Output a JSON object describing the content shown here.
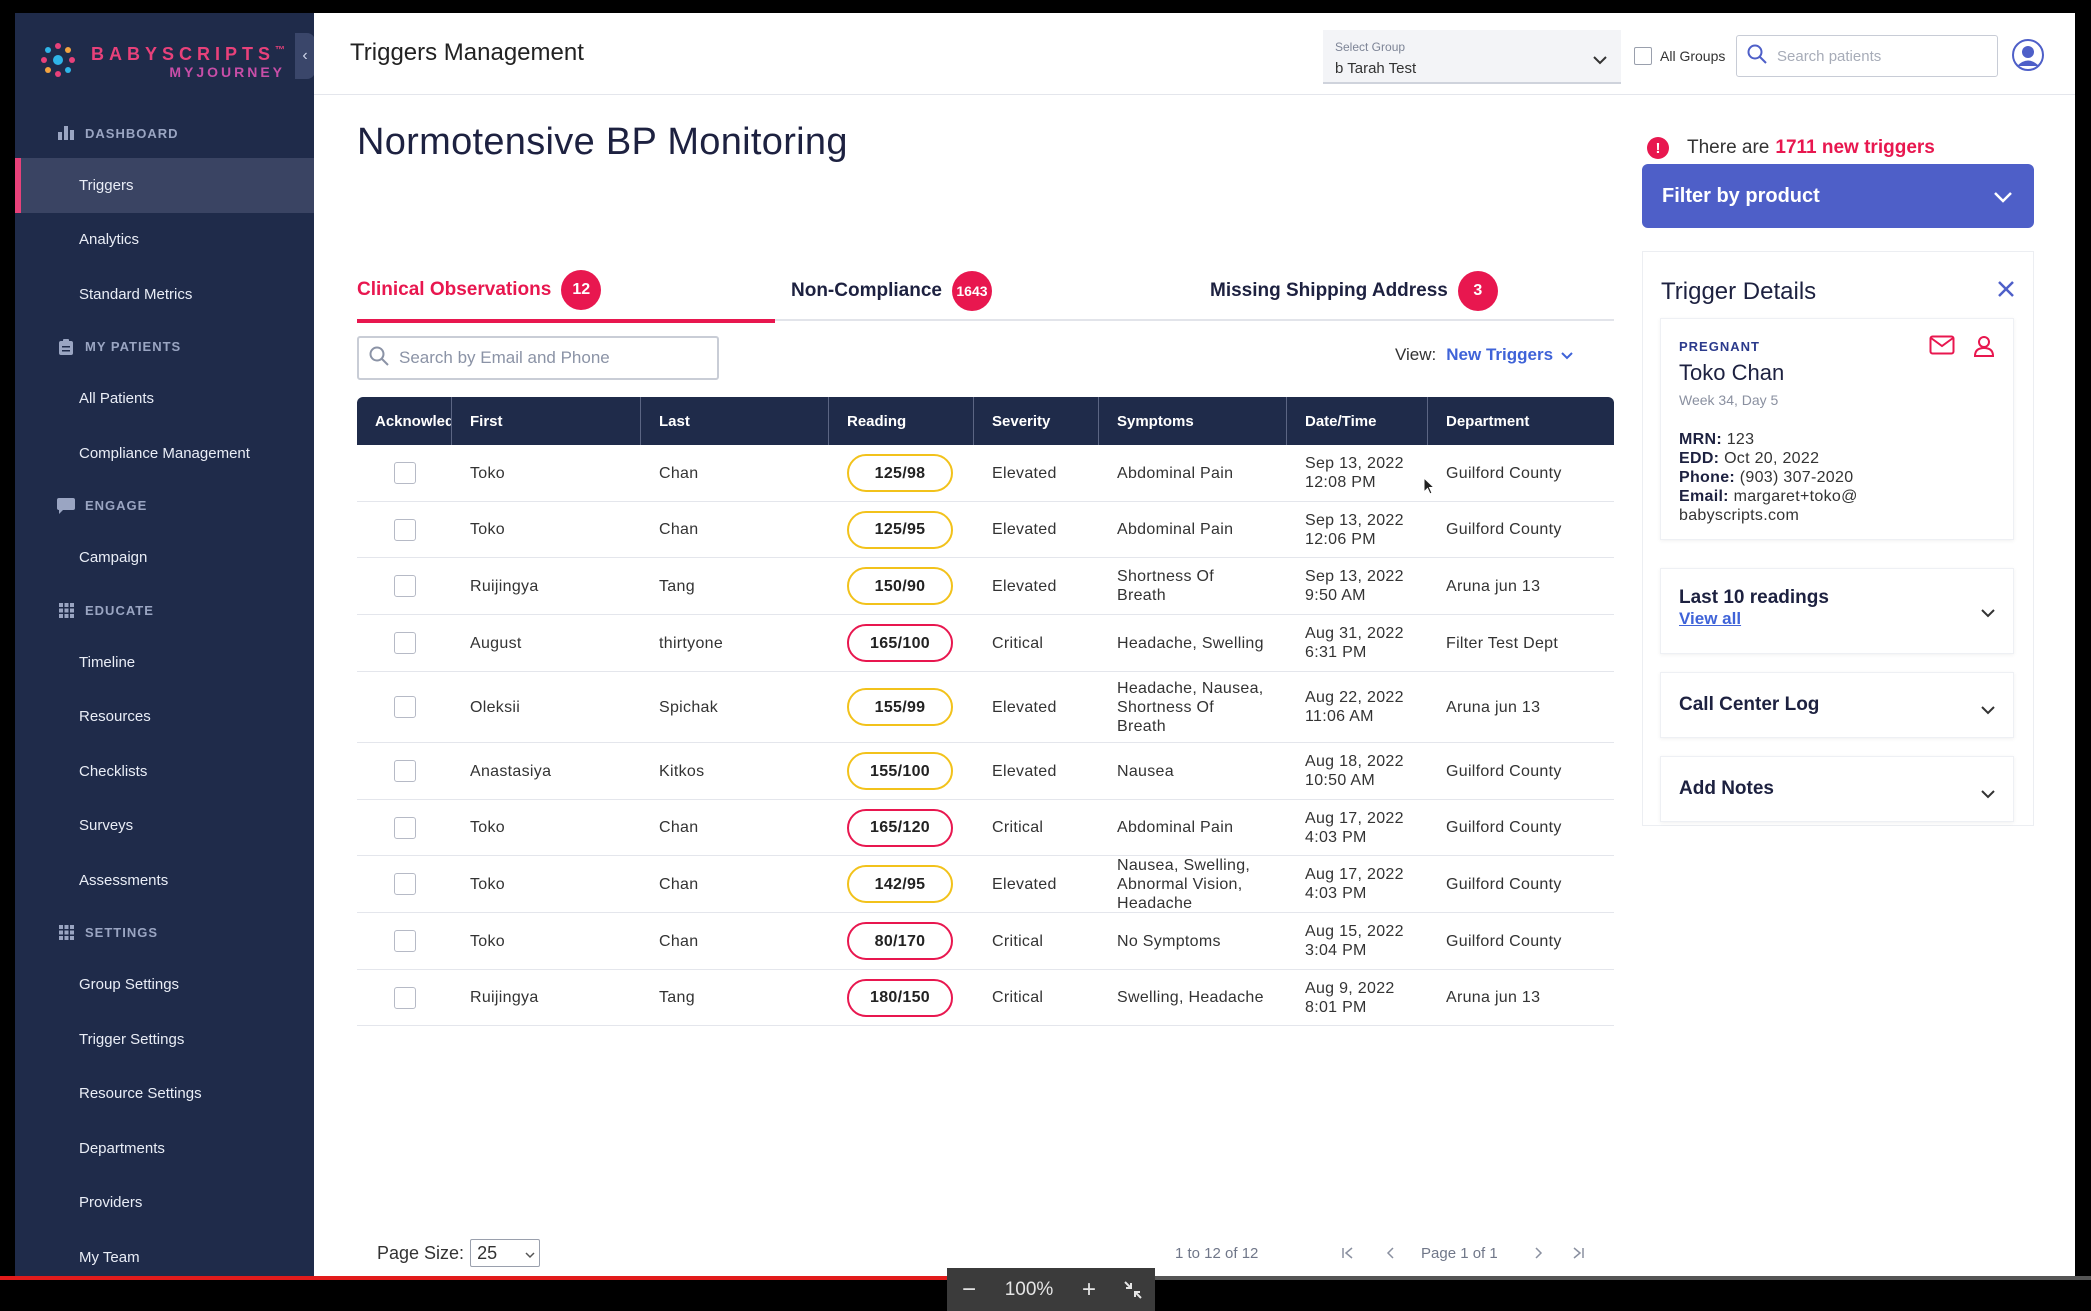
{
  "brand": {
    "name": "BABYSCRIPTS",
    "tm": "™",
    "sub": "MYJOURNEY"
  },
  "sidebar": {
    "sections": [
      {
        "label": "DASHBOARD",
        "icon": "bar-chart-icon",
        "items": [
          "Triggers",
          "Analytics",
          "Standard Metrics"
        ]
      },
      {
        "label": "MY PATIENTS",
        "icon": "clipboard-icon",
        "items": [
          "All Patients",
          "Compliance Management"
        ]
      },
      {
        "label": "ENGAGE",
        "icon": "chat-icon",
        "items": [
          "Campaign"
        ]
      },
      {
        "label": "EDUCATE",
        "icon": "grid-icon",
        "items": [
          "Timeline",
          "Resources",
          "Checklists",
          "Surveys",
          "Assessments"
        ]
      },
      {
        "label": "SETTINGS",
        "icon": "grid-icon",
        "items": [
          "Group Settings",
          "Trigger Settings",
          "Resource Settings",
          "Departments",
          "Providers",
          "My Team"
        ]
      }
    ],
    "active_item": "Triggers"
  },
  "header": {
    "title": "Triggers Management",
    "group_label": "Select Group",
    "group_value": "b Tarah Test",
    "all_groups": "All Groups",
    "search_placeholder": "Search patients"
  },
  "page_title": "Normotensive BP Monitoring",
  "tabs": [
    {
      "label": "Clinical Observations",
      "count": "12",
      "active": true
    },
    {
      "label": "Non-Compliance",
      "count": "1643",
      "active": false
    },
    {
      "label": "Missing Shipping Address",
      "count": "3",
      "active": false
    }
  ],
  "table_search_placeholder": "Search by Email and Phone",
  "view": {
    "label": "View:",
    "value": "New Triggers"
  },
  "table": {
    "columns": [
      "Acknowledge",
      "First",
      "Last",
      "Reading",
      "Severity",
      "Symptoms",
      "Date/Time",
      "Department"
    ],
    "rows": [
      {
        "first": "Toko",
        "last": "Chan",
        "reading": "125/98",
        "severity": "Elevated",
        "symptoms": "Abdominal Pain",
        "date": "Sep 13, 2022 12:08 PM",
        "department": "Guilford County"
      },
      {
        "first": "Toko",
        "last": "Chan",
        "reading": "125/95",
        "severity": "Elevated",
        "symptoms": "Abdominal Pain",
        "date": "Sep 13, 2022 12:06 PM",
        "department": "Guilford County"
      },
      {
        "first": "Ruijingya",
        "last": "Tang",
        "reading": "150/90",
        "severity": "Elevated",
        "symptoms": "Shortness Of Breath",
        "date": "Sep 13, 2022 9:50 AM",
        "department": "Aruna jun 13"
      },
      {
        "first": "August",
        "last": "thirtyone",
        "reading": "165/100",
        "severity": "Critical",
        "symptoms": "Headache, Swelling",
        "date": "Aug 31, 2022 6:31 PM",
        "department": "Filter Test Dept"
      },
      {
        "first": "Oleksii",
        "last": "Spichak",
        "reading": "155/99",
        "severity": "Elevated",
        "symptoms": "Headache, Nausea, Shortness Of Breath",
        "date": "Aug 22, 2022 11:06 AM",
        "department": "Aruna jun 13"
      },
      {
        "first": "Anastasiya",
        "last": "Kitkos",
        "reading": "155/100",
        "severity": "Elevated",
        "symptoms": "Nausea",
        "date": "Aug 18, 2022 10:50 AM",
        "department": "Guilford County"
      },
      {
        "first": "Toko",
        "last": "Chan",
        "reading": "165/120",
        "severity": "Critical",
        "symptoms": "Abdominal Pain",
        "date": "Aug 17, 2022 4:03 PM",
        "department": "Guilford County"
      },
      {
        "first": "Toko",
        "last": "Chan",
        "reading": "142/95",
        "severity": "Elevated",
        "symptoms": "Nausea, Swelling, Abnormal Vision, Headache",
        "date": "Aug 17, 2022 4:03 PM",
        "department": "Guilford County"
      },
      {
        "first": "Toko",
        "last": "Chan",
        "reading": "80/170",
        "severity": "Critical",
        "symptoms": "No Symptoms",
        "date": "Aug 15, 2022 3:04 PM",
        "department": "Guilford County"
      },
      {
        "first": "Ruijingya",
        "last": "Tang",
        "reading": "180/150",
        "severity": "Critical",
        "symptoms": "Swelling, Headache",
        "date": "Aug 9, 2022 8:01 PM",
        "department": "Aruna jun 13"
      }
    ]
  },
  "pager": {
    "size_label": "Page Size:",
    "size_value": "25",
    "count": "1 to 12 of 12",
    "page": "Page 1 of 1"
  },
  "alert": {
    "prefix": "There are",
    "highlight": "1711 new triggers"
  },
  "filter_product": "Filter by product",
  "details": {
    "title": "Trigger Details",
    "status": "PREGNANT",
    "name": "Toko Chan",
    "week": "Week 34, Day 5",
    "mrn_label": "MRN:",
    "mrn": "123",
    "edd_label": "EDD:",
    "edd": "Oct 20, 2022",
    "phone_label": "Phone:",
    "phone": "(903) 307-2020",
    "email_label": "Email:",
    "email_1": "margaret+toko@",
    "email_2": "babyscripts.com",
    "last_readings": "Last 10 readings",
    "view_all": "View all",
    "call_log": "Call Center Log",
    "add_notes": "Add Notes"
  },
  "video": {
    "zoom": "100%"
  },
  "colors": {
    "sidebar": "#1f2b4a",
    "accent": "#e8174f",
    "primary": "#4e5fc8",
    "elevated": "#f2c21b"
  }
}
